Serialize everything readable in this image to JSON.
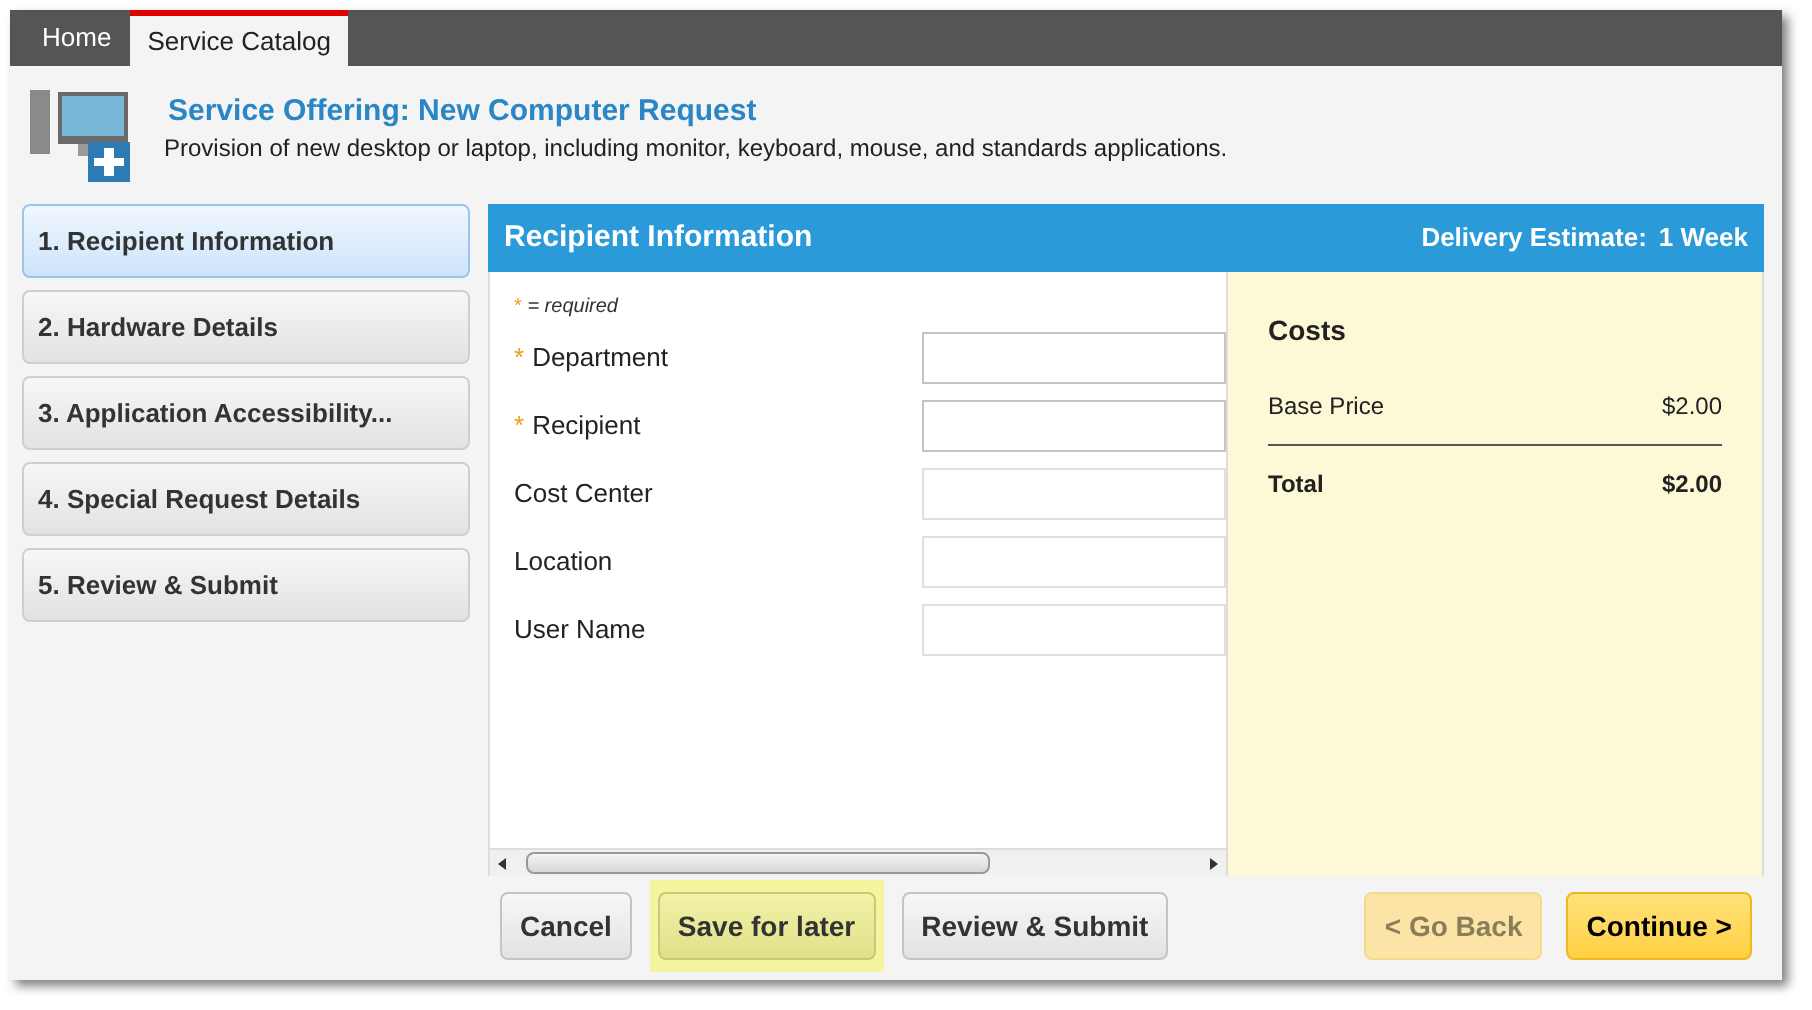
{
  "tabs": [
    {
      "label": "Home",
      "selected": false
    },
    {
      "label": "Service Catalog",
      "selected": true
    }
  ],
  "header": {
    "title": "Service Offering: New Computer Request",
    "description": "Provision of new desktop or laptop, including monitor, keyboard, mouse, and standards applications."
  },
  "steps": [
    {
      "label": "1. Recipient Information",
      "selected": true
    },
    {
      "label": "2. Hardware Details",
      "selected": false
    },
    {
      "label": "3. Application Accessibility...",
      "selected": false
    },
    {
      "label": "4. Special Request Details",
      "selected": false
    },
    {
      "label": "5. Review & Submit",
      "selected": false
    }
  ],
  "panel": {
    "title": "Recipient Information",
    "delivery_label": "Delivery Estimate:",
    "delivery_value": "1 Week"
  },
  "form": {
    "required_mark": "*",
    "required_note": "= required",
    "fields": [
      {
        "label": "Department",
        "required": true
      },
      {
        "label": "Recipient",
        "required": true
      },
      {
        "label": "Cost Center",
        "required": false
      },
      {
        "label": "Location",
        "required": false
      },
      {
        "label": "User Name",
        "required": false
      }
    ]
  },
  "costs": {
    "title": "Costs",
    "items": [
      {
        "label": "Base Price",
        "value": "$2.00"
      }
    ],
    "total_label": "Total",
    "total_value": "$2.00"
  },
  "buttons": [
    {
      "label": "Cancel",
      "kind": "default",
      "highlighted": false,
      "disabled": false
    },
    {
      "label": "Save for later",
      "kind": "default",
      "highlighted": true,
      "disabled": false
    },
    {
      "label": "Review & Submit",
      "kind": "default",
      "highlighted": false,
      "disabled": false
    },
    {
      "label": "< Go Back",
      "kind": "primary",
      "highlighted": false,
      "disabled": true
    },
    {
      "label": "Continue >",
      "kind": "primary",
      "highlighted": false,
      "disabled": false
    }
  ]
}
